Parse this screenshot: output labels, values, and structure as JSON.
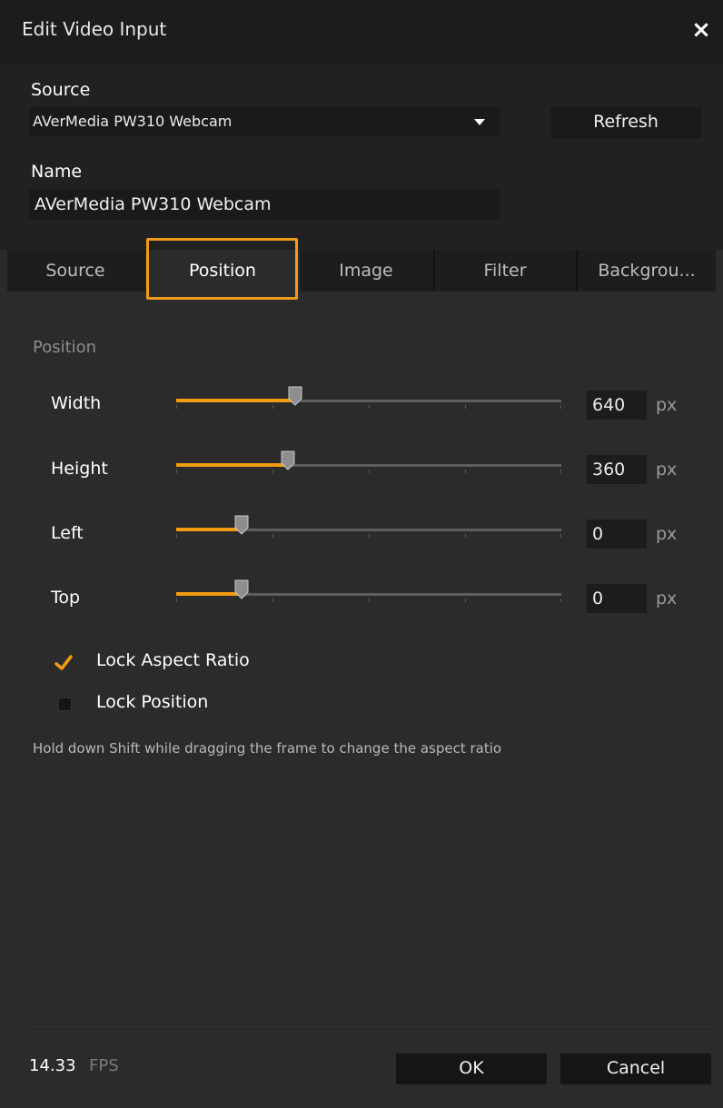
{
  "window": {
    "title": "Edit Video Input",
    "close_icon": "×"
  },
  "source": {
    "label": "Source",
    "selected": "AVerMedia PW310 Webcam",
    "refresh_label": "Refresh"
  },
  "name": {
    "label": "Name",
    "value": "AVerMedia PW310 Webcam"
  },
  "tabs": [
    {
      "label": "Source"
    },
    {
      "label": "Position"
    },
    {
      "label": "Image"
    },
    {
      "label": "Filter"
    },
    {
      "label": "Backgrou..."
    }
  ],
  "active_tab": "Position",
  "position": {
    "section_title": "Position",
    "rows": [
      {
        "label": "Width",
        "value": "640",
        "unit": "px",
        "fill_fraction": 0.31
      },
      {
        "label": "Height",
        "value": "360",
        "unit": "px",
        "fill_fraction": 0.29
      },
      {
        "label": "Left",
        "value": "0",
        "unit": "px",
        "fill_fraction": 0.17
      },
      {
        "label": "Top",
        "value": "0",
        "unit": "px",
        "fill_fraction": 0.17
      }
    ]
  },
  "options": {
    "lock_aspect_ratio": {
      "label": "Lock Aspect Ratio",
      "checked": true
    },
    "lock_position": {
      "label": "Lock Position",
      "checked": false
    }
  },
  "hint": "Hold down Shift while dragging the frame to change the aspect ratio",
  "footer": {
    "fps_value": "14.33",
    "fps_unit": "FPS",
    "ok_label": "OK",
    "cancel_label": "Cancel"
  },
  "colors": {
    "accent": "#f39c12",
    "highlight_border": "#f09a1a",
    "background": "#2b2b2b"
  }
}
